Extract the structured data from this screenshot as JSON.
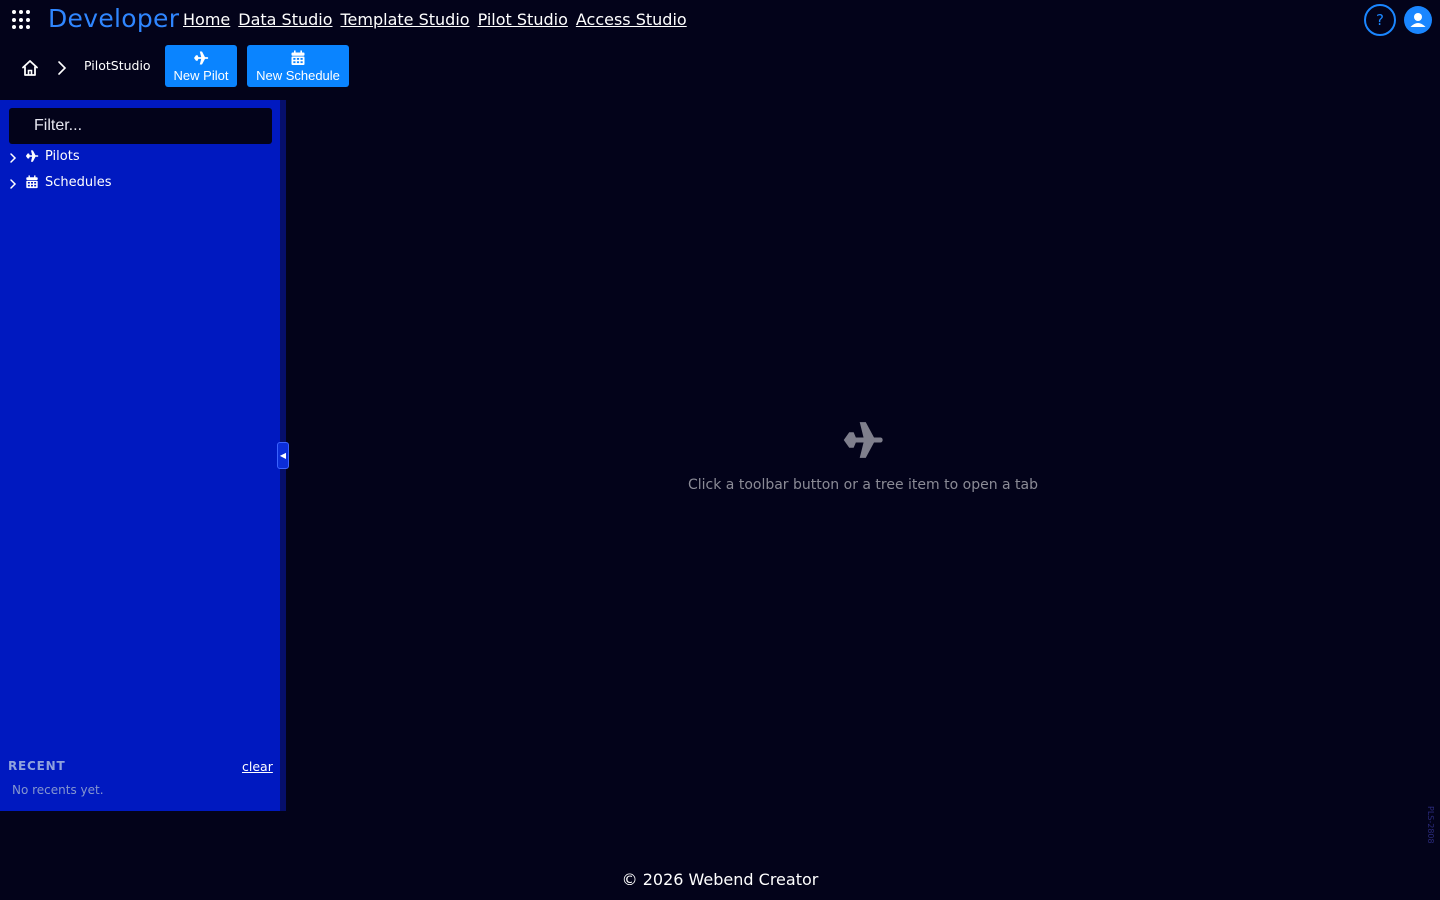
{
  "app": {
    "brand": "Developer",
    "nav": [
      "Home",
      "Data Studio",
      "Template Studio",
      "Pilot Studio",
      "Access Studio"
    ],
    "help_label": "?"
  },
  "toolbar": {
    "breadcrumb": "PilotStudio",
    "new_pilot_label": "New Pilot",
    "new_schedule_label": "New Schedule"
  },
  "sidebar": {
    "filter_placeholder": "Filter...",
    "tree": [
      {
        "label": "Pilots",
        "icon": "plane-icon"
      },
      {
        "label": "Schedules",
        "icon": "calendar-icon"
      }
    ],
    "recent_title": "RECENT",
    "recent_clear": "clear",
    "recent_empty": "No recents yet.",
    "collapse_glyph": "◀"
  },
  "main": {
    "empty_message": "Click a toolbar button or a tree item to open a tab",
    "empty_icon": "plane-icon"
  },
  "version": "PLS-2808",
  "footer": "© 2026 Webend Creator",
  "colors": {
    "background": "#03031a",
    "sidebar": "#0019c0",
    "accent": "#0a84ff",
    "brand": "#2f86ff"
  }
}
